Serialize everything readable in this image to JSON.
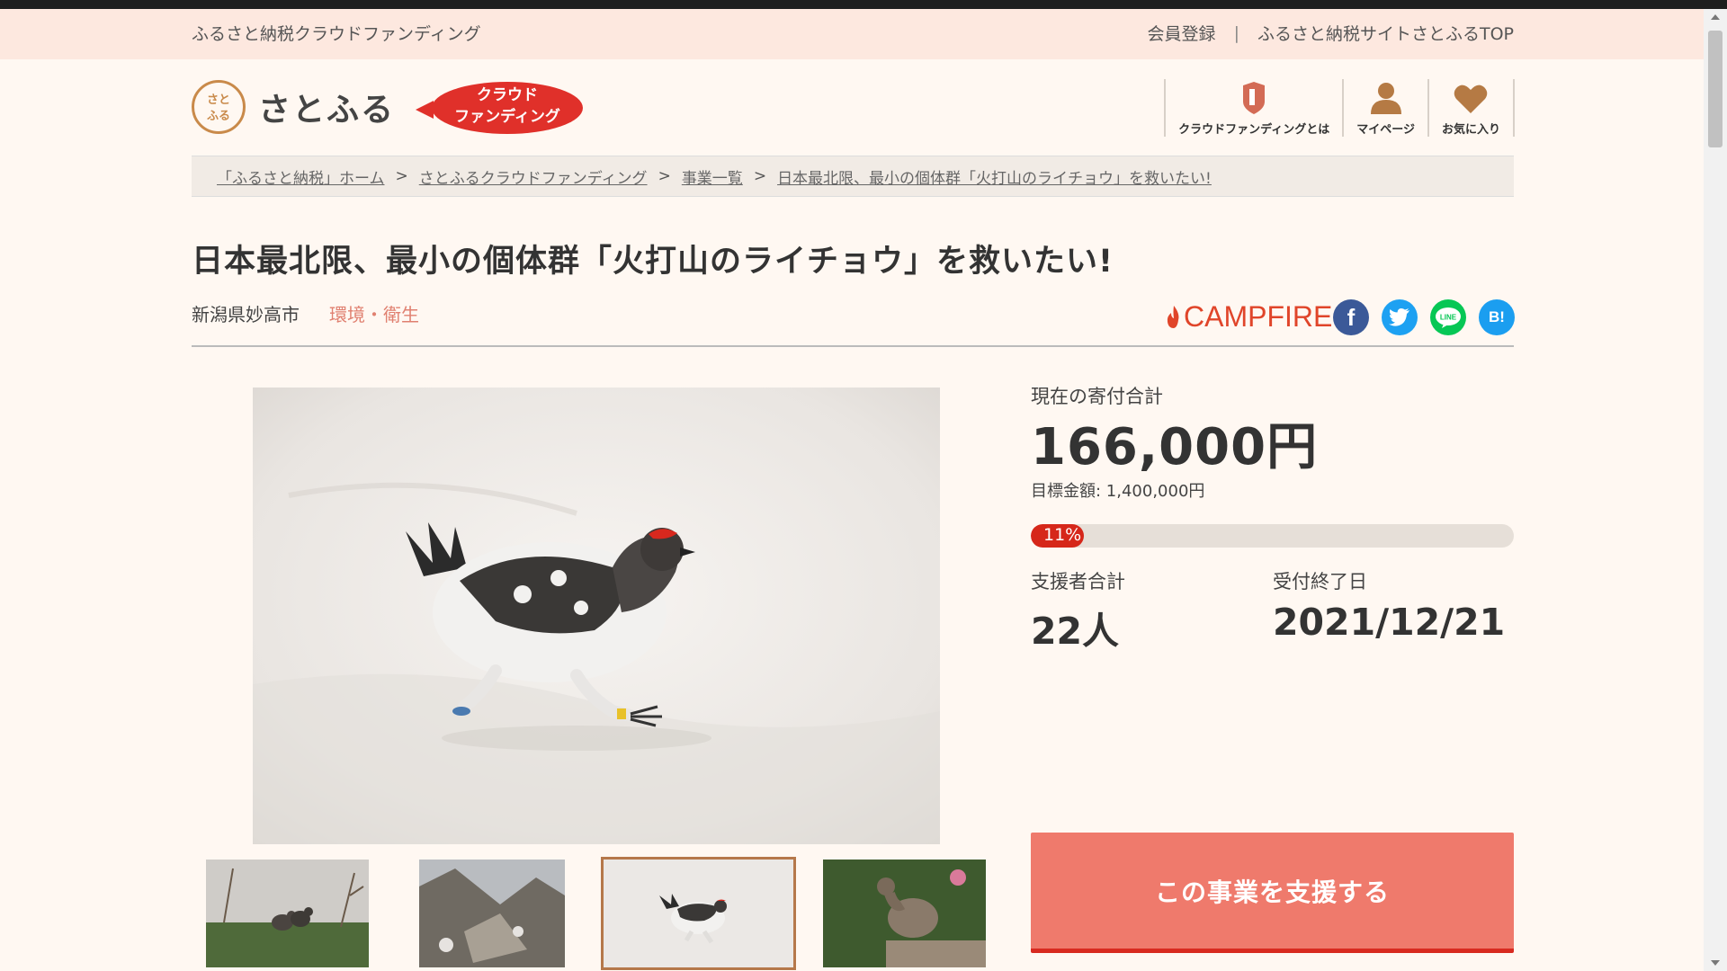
{
  "header": {
    "site_name": "ふるさと納税クラウドファンディング",
    "register_link": "会員登録",
    "separator": "|",
    "top_link": "ふるさと納税サイトさとふるTOP"
  },
  "logo": {
    "mark_text": "さとふる",
    "brand_text": "さとふる",
    "badge_line1": "クラウド",
    "badge_line2": "ファンディング"
  },
  "nav": [
    {
      "label": "クラウドファンディングとは",
      "icon": "shield-book-icon"
    },
    {
      "label": "マイページ",
      "icon": "user-icon"
    },
    {
      "label": "お気に入り",
      "icon": "heart-icon"
    }
  ],
  "breadcrumb": [
    "「ふるさと納税」ホーム",
    "さとふるクラウドファンディング",
    "事業一覧",
    "日本最北限、最小の個体群「火打山のライチョウ」を救いたい!"
  ],
  "breadcrumb_sep": ">",
  "project": {
    "title": "日本最北限、最小の個体群「火打山のライチョウ」を救いたい!",
    "location": "新潟県妙高市",
    "category": "環境・衛生"
  },
  "partner": {
    "name": "CAMPFIRE"
  },
  "share": {
    "facebook": "f",
    "line": "LINE",
    "hatena": "B!"
  },
  "stats": {
    "total_label": "現在の寄付合計",
    "total_value": "166,000円",
    "goal_text": "目標金額: 1,400,000円",
    "progress_percent": 11,
    "progress_text": "11%",
    "supporters_label": "支援者合計",
    "supporters_value": "22人",
    "deadline_label": "受付終了日",
    "deadline_value": "2021/12/21"
  },
  "cta": {
    "label": "この事業を支援する"
  },
  "colors": {
    "accent": "#ef7a6c",
    "progress": "#d6271a",
    "category": "#e08070",
    "campfire": "#e0452a",
    "header_bg": "#fde8df"
  }
}
